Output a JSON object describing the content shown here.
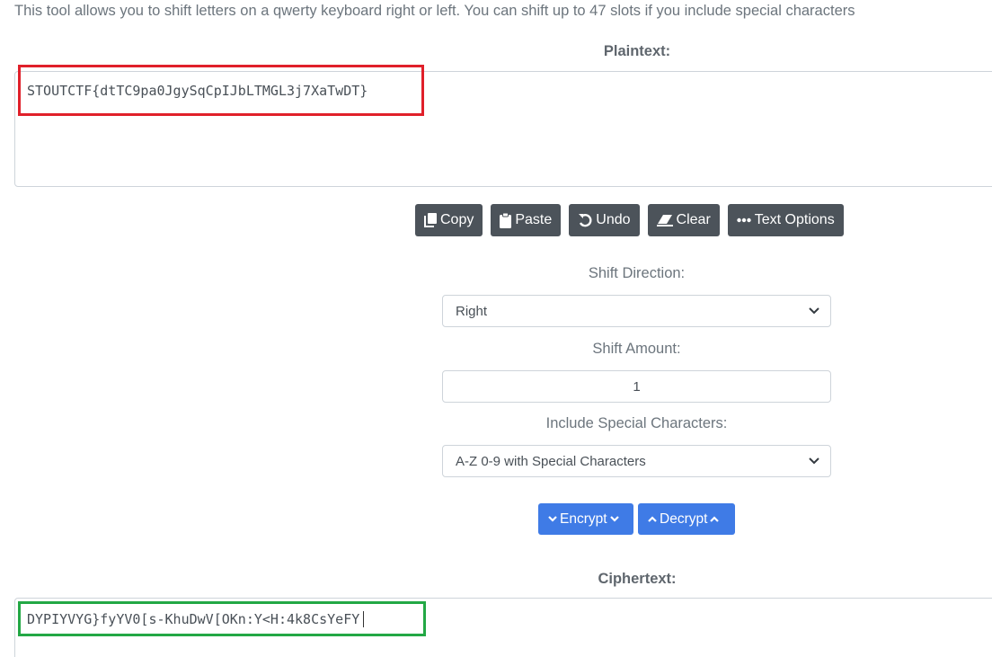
{
  "intro_text": "This tool allows you to shift letters on a qwerty keyboard right or left. You can shift up to 47 slots if you include special characters",
  "plaintext": {
    "label": "Plaintext:",
    "value": "STOUTCTF{dtTC9pa0JgySqCpIJbLTMGL3j7XaTwDT}"
  },
  "toolbar": {
    "copy_label": "Copy",
    "paste_label": "Paste",
    "undo_label": "Undo",
    "clear_label": "Clear",
    "text_options_label": "Text Options"
  },
  "shift_direction": {
    "label": "Shift Direction:",
    "selected": "Right"
  },
  "shift_amount": {
    "label": "Shift Amount:",
    "value": "1"
  },
  "special_chars": {
    "label": "Include Special Characters:",
    "selected": "A-Z 0-9 with Special Characters"
  },
  "actions": {
    "encrypt_label": "Encrypt",
    "decrypt_label": "Decrypt"
  },
  "ciphertext": {
    "label": "Ciphertext:",
    "value": "DYPIYVYG}fyYV0[s-KhuDwV[OKn:Y<H:4k8CsYeFY"
  },
  "colors": {
    "dark_button": "#4c535a",
    "primary_button": "#3f7be6",
    "highlight_red": "#e0202a",
    "highlight_green": "#23a845"
  },
  "icons": [
    "copy-icon",
    "paste-icon",
    "undo-icon",
    "eraser-icon",
    "ellipsis-icon",
    "chevron-down-icon",
    "chevron-up-icon"
  ]
}
